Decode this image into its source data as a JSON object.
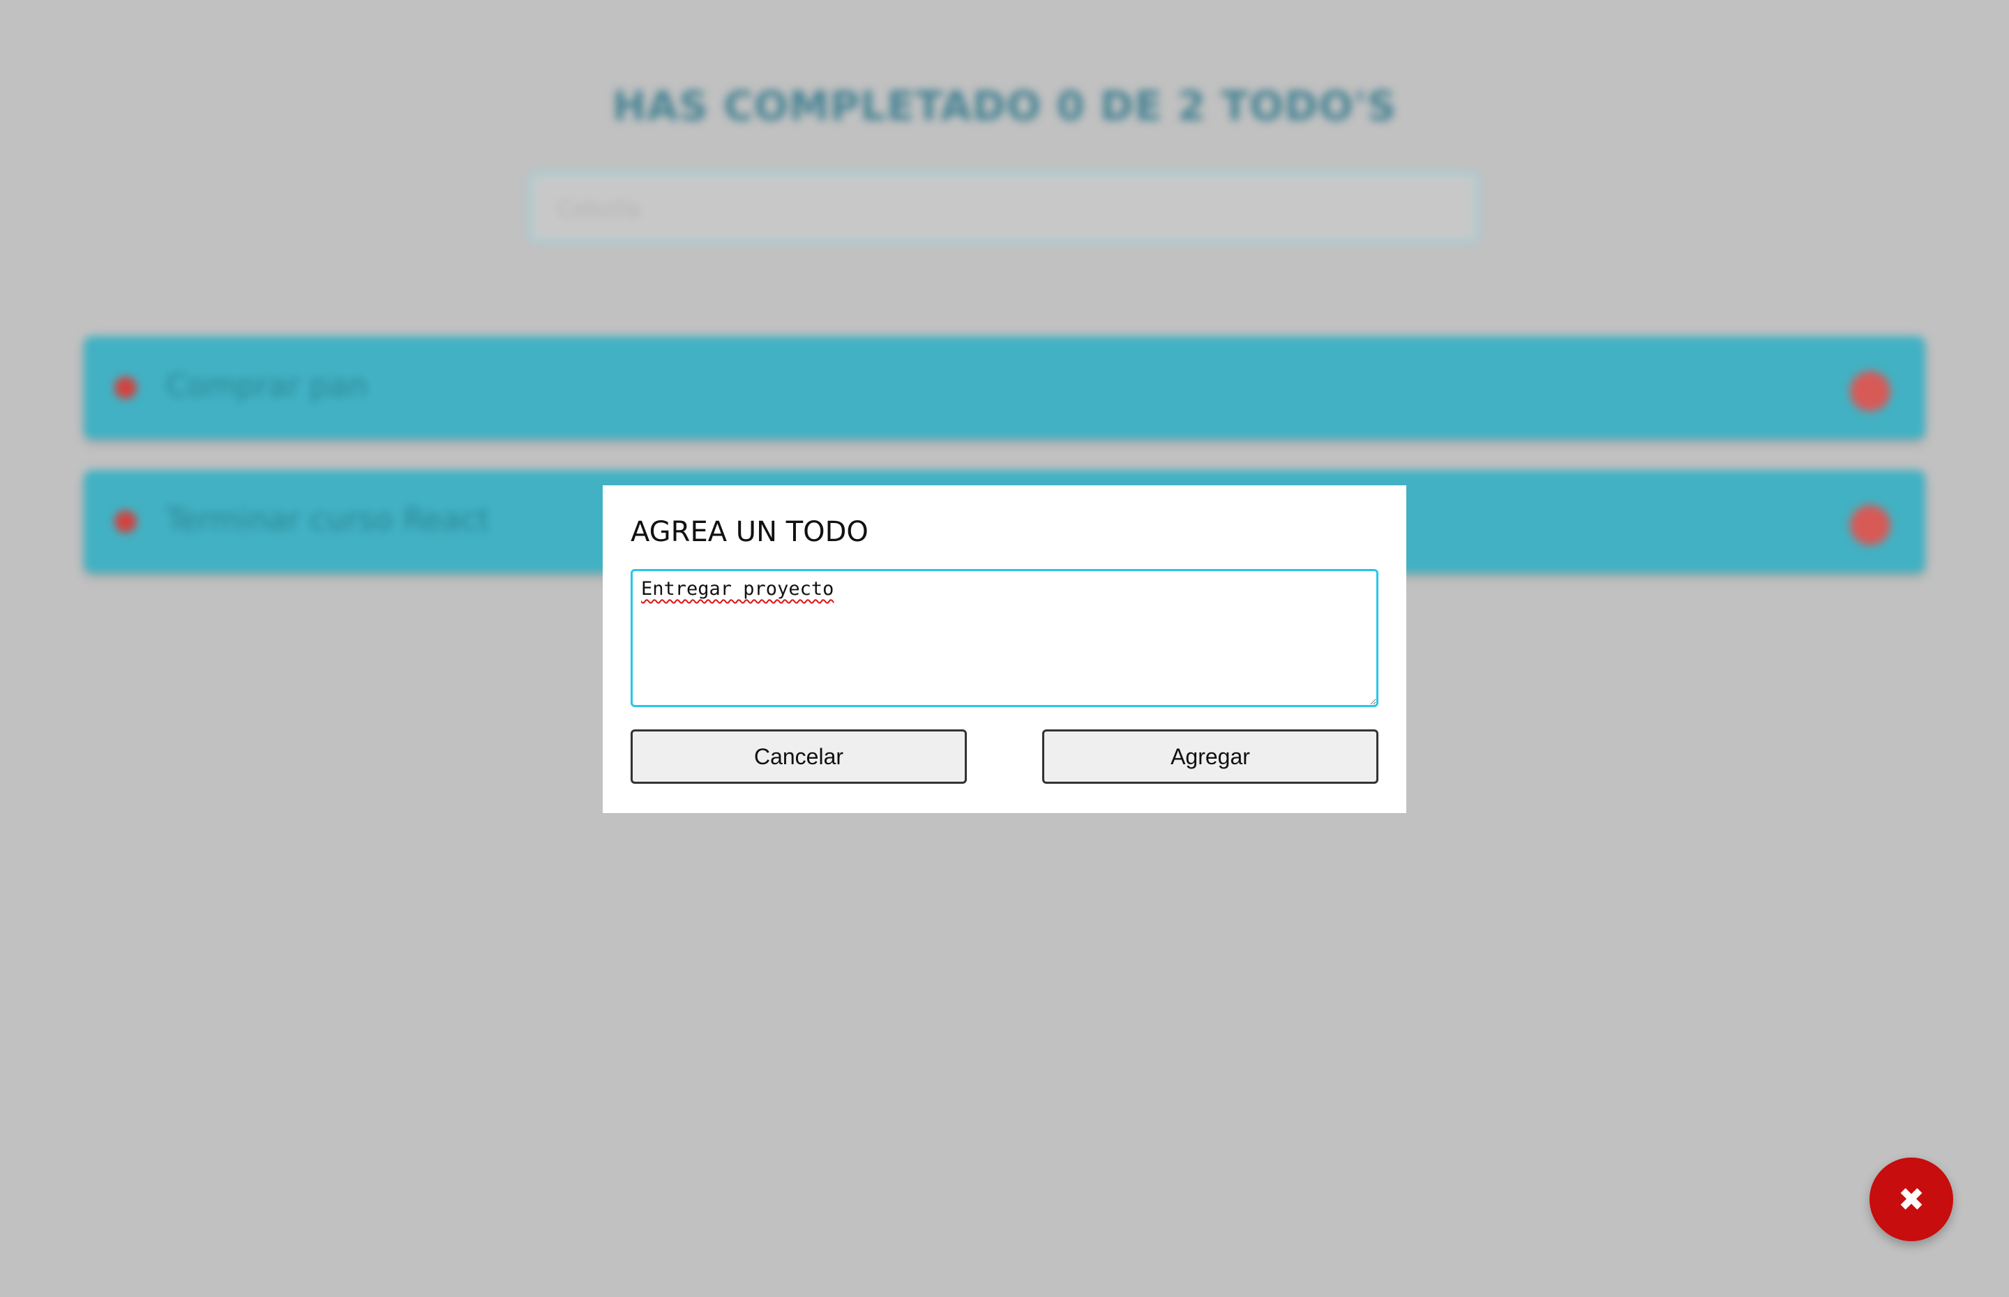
{
  "background": {
    "title": "HAS COMPLETADO 0 DE 2 TODO'S",
    "search_placeholder": "Cebolla",
    "todos": [
      {
        "text": "Comprar pan"
      },
      {
        "text": "Terminar curso React"
      }
    ],
    "colors": {
      "item_bg": "#41b1c3",
      "check": "#d2423f",
      "delete": "#d75a57"
    }
  },
  "modal": {
    "title": "AGREA UN TODO",
    "textarea_value": "Entregar proyecto",
    "cancel_label": "Cancelar",
    "add_label": "Agregar"
  },
  "fab": {
    "icon": "close-icon",
    "glyph": "✖",
    "color": "#c70d0d"
  }
}
